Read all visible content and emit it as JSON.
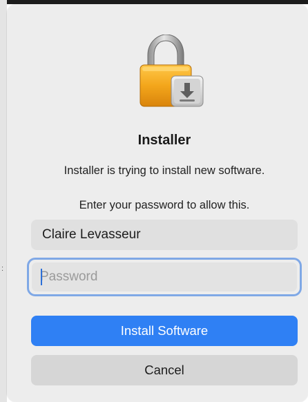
{
  "dialog": {
    "title": "Installer",
    "message": "Installer is trying to install new software.",
    "prompt": "Enter your password to allow this.",
    "icon": "lock-with-installer-icon"
  },
  "username": {
    "value": "Claire Levasseur"
  },
  "password": {
    "placeholder": "Password",
    "value": ""
  },
  "buttons": {
    "install_label": "Install Software",
    "cancel_label": "Cancel"
  },
  "colors": {
    "accent": "#2f80f4",
    "focus_ring": "#7fa8e6",
    "lock_body": "#f0a51c"
  }
}
